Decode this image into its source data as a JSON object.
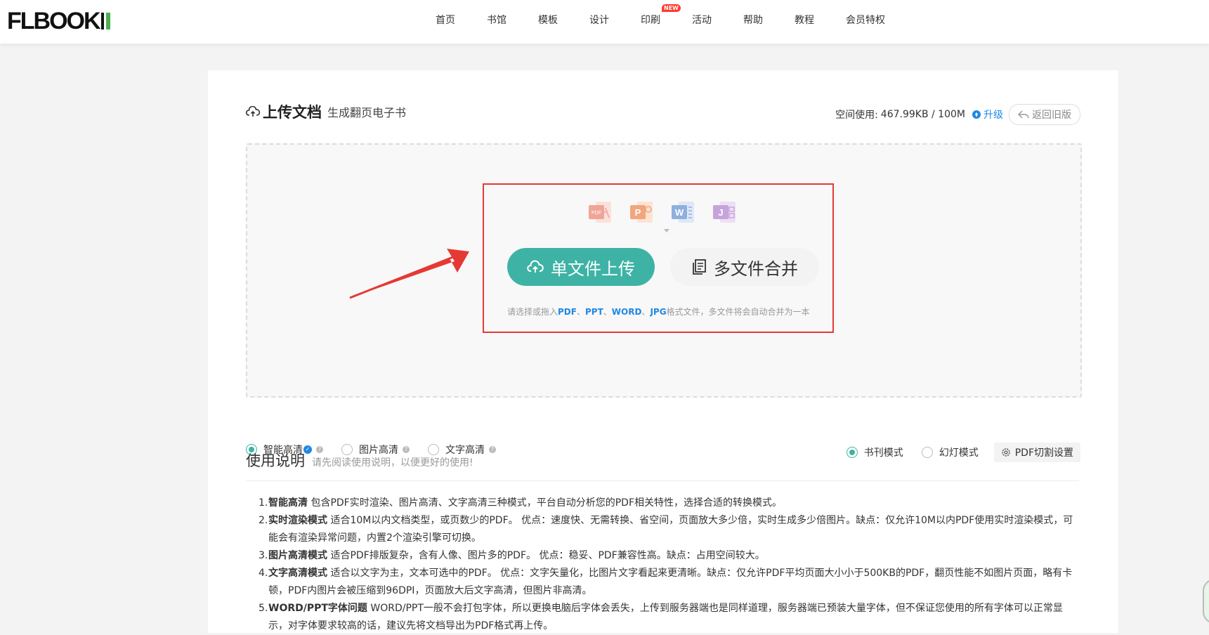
{
  "header": {
    "logo_text": "FLBOOK",
    "nav": [
      {
        "label": "首页"
      },
      {
        "label": "书馆"
      },
      {
        "label": "模板"
      },
      {
        "label": "设计"
      },
      {
        "label": "印刷",
        "badge": "NEW"
      },
      {
        "label": "活动"
      },
      {
        "label": "帮助"
      },
      {
        "label": "教程"
      },
      {
        "label": "会员特权"
      }
    ]
  },
  "upload": {
    "title": "上传文档",
    "subtitle": "生成翻页电子书",
    "space_label": "空间使用:",
    "space_value": "467.99KB / 100M",
    "upgrade_label": "升级",
    "back_label": "返回旧版",
    "file_types": [
      "pdf-icon",
      "ppt-icon",
      "word-icon",
      "jpg-icon"
    ],
    "single_upload_label": "单文件上传",
    "multi_merge_label": "多文件合并",
    "hint_prefix": "请选择或拖入",
    "hint_pdf": "PDF",
    "hint_sep1": "、",
    "hint_ppt": "PPT",
    "hint_sep2": "、",
    "hint_word": "WORD",
    "hint_sep3": "、",
    "hint_jpg": "JPG",
    "hint_suffix": "格式文件，多文件将会自动合并为一本"
  },
  "options": {
    "quality": [
      {
        "label": "智能高清",
        "checked": true,
        "vip": true
      },
      {
        "label": "图片高清",
        "checked": false
      },
      {
        "label": "文字高清",
        "checked": false
      }
    ],
    "mode": [
      {
        "label": "书刊模式",
        "checked": true
      },
      {
        "label": "幻灯模式",
        "checked": false
      }
    ],
    "pdf_cut_label": "PDF切割设置"
  },
  "instructions": {
    "title": "使用说明",
    "subtitle": "请先阅读使用说明，以便更好的使用!",
    "items": [
      {
        "num": "1.",
        "bold": "智能高清",
        "text": " 包含PDF实时渲染、图片高清、文字高清三种模式，平台自动分析您的PDF相关特性，选择合适的转换模式。"
      },
      {
        "num": "2.",
        "bold": "实时渲染模式",
        "text": " 适合10M以内文档类型，或页数少的PDF。 优点：速度快、无需转换、省空间，页面放大多少倍，实时生成多少倍图片。缺点：仅允许10M以内PDF使用实时渲染模式，可能会有渲染异常问题，内置2个渲染引擎可切换。"
      },
      {
        "num": "3.",
        "bold": "图片高清模式",
        "text": " 适合PDF排版复杂，含有人像、图片多的PDF。 优点：稳妥、PDF兼容性高。缺点：占用空间较大。"
      },
      {
        "num": "4.",
        "bold": "文字高清模式",
        "text": " 适合以文字为主，文本可选中的PDF。 优点：文字矢量化，比图片文字看起来更清晰。缺点：仅允许PDF平均页面大小小于500KB的PDF，翻页性能不如图片页面，略有卡顿，PDF内图片会被压缩到96DPI，页面放大后文字高清，但图片非高清。"
      },
      {
        "num": "5.",
        "bold": "WORD/PPT字体问题",
        "text": " WORD/PPT一般不会打包字体，所以更换电脑后字体会丢失，上传到服务器端也是同样道理，服务器端已预装大量字体，但不保证您使用的所有字体可以正常显示，对字体要求较高的话，建议先将文档导出为PDF格式再上传。"
      }
    ]
  },
  "colors": {
    "accent": "#3eb3a5",
    "link": "#1e88e5",
    "annotation": "#e53935"
  }
}
